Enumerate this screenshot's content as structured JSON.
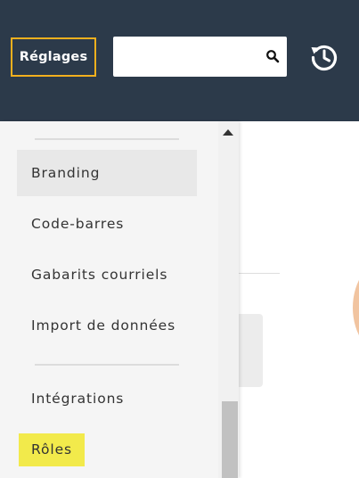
{
  "header": {
    "settings_label": "Réglages",
    "search_value": "",
    "search_placeholder": "",
    "icons": [
      "search-icon",
      "history-icon"
    ],
    "colors": {
      "background": "#2c3a4a",
      "settings_border": "#f2b01e"
    }
  },
  "settings_menu": {
    "items": [
      {
        "label": "Branding",
        "state": "hovered"
      },
      {
        "label": "Code-barres"
      },
      {
        "label": "Gabarits courriels"
      },
      {
        "label": "Import de données"
      },
      {
        "label": "Intégrations"
      },
      {
        "label": "Rôles",
        "state": "highlighted"
      }
    ],
    "colors": {
      "highlight": "#f2ea4b",
      "hover": "#e8e8e8"
    }
  }
}
